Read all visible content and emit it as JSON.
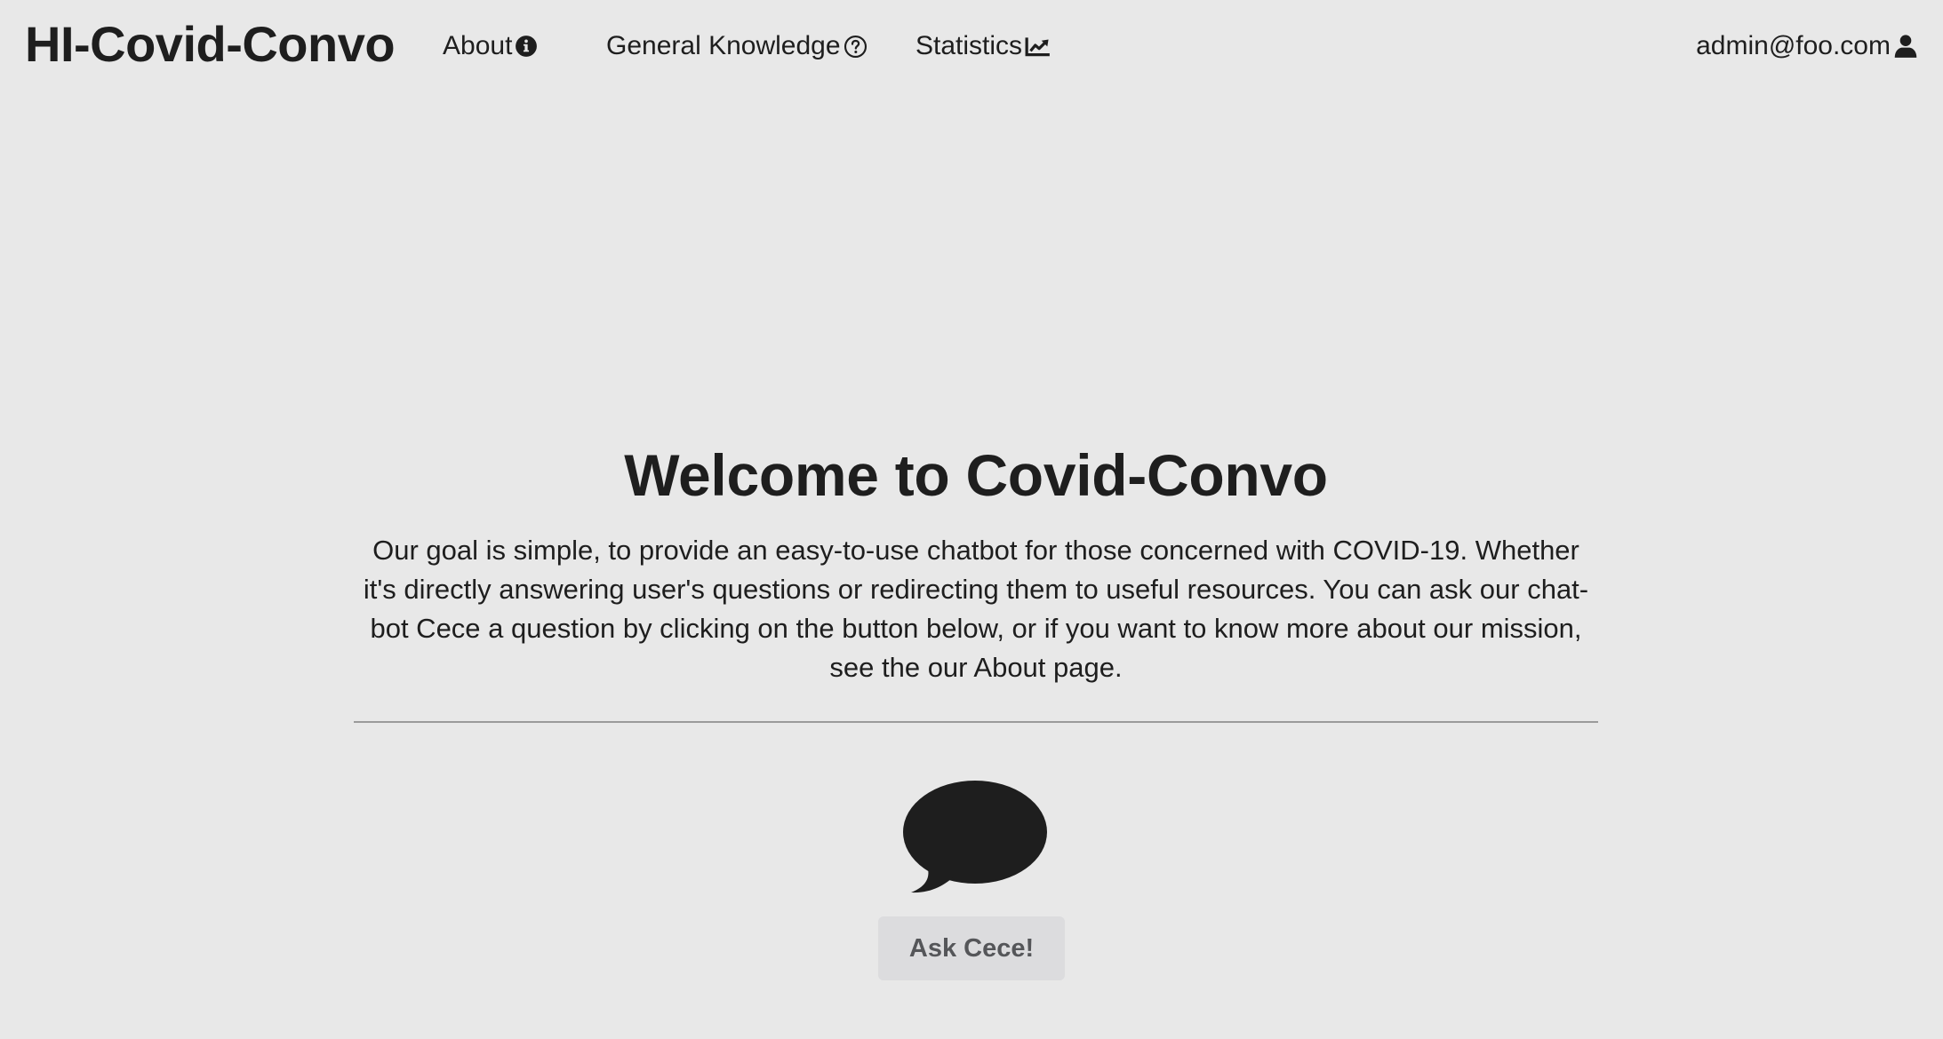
{
  "brand": "HI-Covid-Convo",
  "nav": {
    "about": {
      "label": "About",
      "icon": "info-circle-icon"
    },
    "general_knowledge": {
      "label": "General Knowledge",
      "icon": "question-circle-icon"
    },
    "statistics": {
      "label": "Statistics",
      "icon": "chart-line-icon"
    },
    "user": {
      "label": "admin@foo.com",
      "icon": "user-icon"
    }
  },
  "hero": {
    "title": "Welcome to Covid-Convo",
    "description": "Our goal is simple, to provide an easy-to-use chatbot for those concerned with COVID-19. Whether it's directly answering user's questions or redirecting them to useful resources. You can ask our chat-bot Cece a question by clicking on the button below, or if you want to know more about our mission, see the our About page.",
    "icon": "speech-bubble-icon",
    "button_label": "Ask Cece!"
  },
  "colors": {
    "background": "#e8e8e8",
    "text": "#1e1e1e",
    "button_bg": "#dcdcde",
    "button_text": "#555659"
  }
}
